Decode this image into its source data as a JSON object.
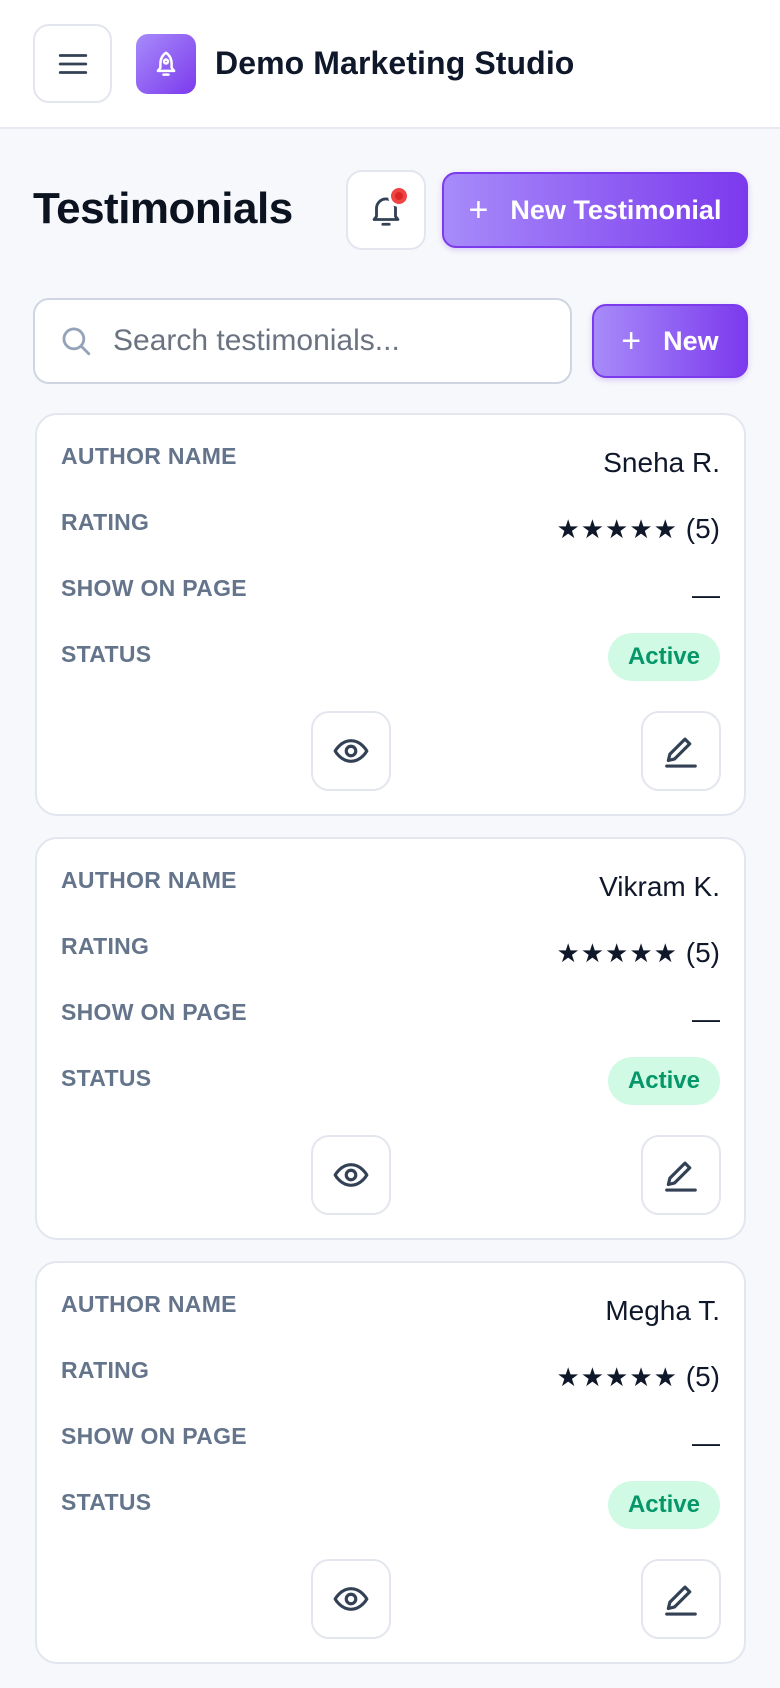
{
  "app": {
    "name": "Demo Marketing Studio"
  },
  "page": {
    "title": "Testimonials",
    "new_testimonial_label": "New Testimonial",
    "new_label": "New",
    "plus_glyph": "+"
  },
  "search": {
    "placeholder": "Search testimonials...",
    "value": ""
  },
  "fields": {
    "author": "AUTHOR NAME",
    "rating": "RATING",
    "show_on_page": "SHOW ON PAGE",
    "status": "STATUS"
  },
  "testimonials": [
    {
      "author": "Sneha R.",
      "stars": "★★★★★",
      "rating": "(5)",
      "show_on_page": "—",
      "status": "Active"
    },
    {
      "author": "Vikram K.",
      "stars": "★★★★★",
      "rating": "(5)",
      "show_on_page": "—",
      "status": "Active"
    },
    {
      "author": "Megha T.",
      "stars": "★★★★★",
      "rating": "(5)",
      "show_on_page": "—",
      "status": "Active"
    }
  ],
  "icons": {
    "menu": "hamburger-menu-icon",
    "logo": "rocket-bell-icon",
    "notifications": "bell-icon",
    "search": "search-icon",
    "view": "eye-icon",
    "edit": "pencil-icon"
  },
  "colors": {
    "accent_start": "#a78bfa",
    "accent_end": "#7c3aed",
    "status_active_bg": "#d1fae5",
    "status_active_text": "#059669",
    "notification_dot": "#ef4444"
  }
}
